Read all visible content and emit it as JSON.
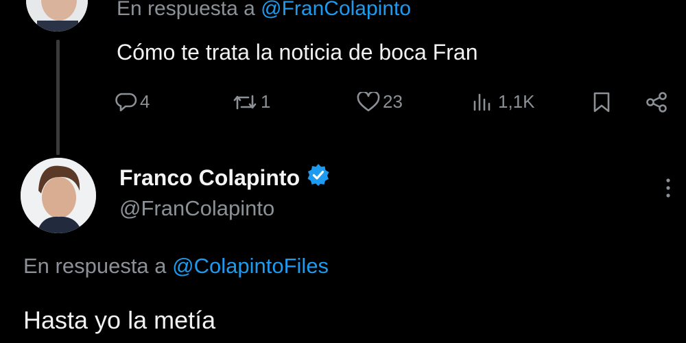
{
  "parent_tweet": {
    "reply_prefix": "En respuesta a",
    "reply_handle": "@FranColapinto",
    "text": "Cómo te trata la noticia de boca Fran",
    "actions": {
      "replies": "4",
      "retweets": "1",
      "likes": "23",
      "views": "1,1K"
    }
  },
  "reply_tweet": {
    "author_name": "Franco Colapinto",
    "author_handle": "@FranColapinto",
    "verified": true,
    "reply_prefix": "En respuesta a",
    "reply_handle": "@ColapintoFiles",
    "text": "Hasta yo la metía"
  },
  "colors": {
    "background": "#000000",
    "text": "#e7e9ea",
    "muted": "#8b9197",
    "accent": "#1d9bf0"
  },
  "icons": [
    "reply-icon",
    "retweet-icon",
    "like-icon",
    "views-icon",
    "bookmark-icon",
    "share-icon",
    "verified-badge-icon",
    "more-options-icon"
  ]
}
